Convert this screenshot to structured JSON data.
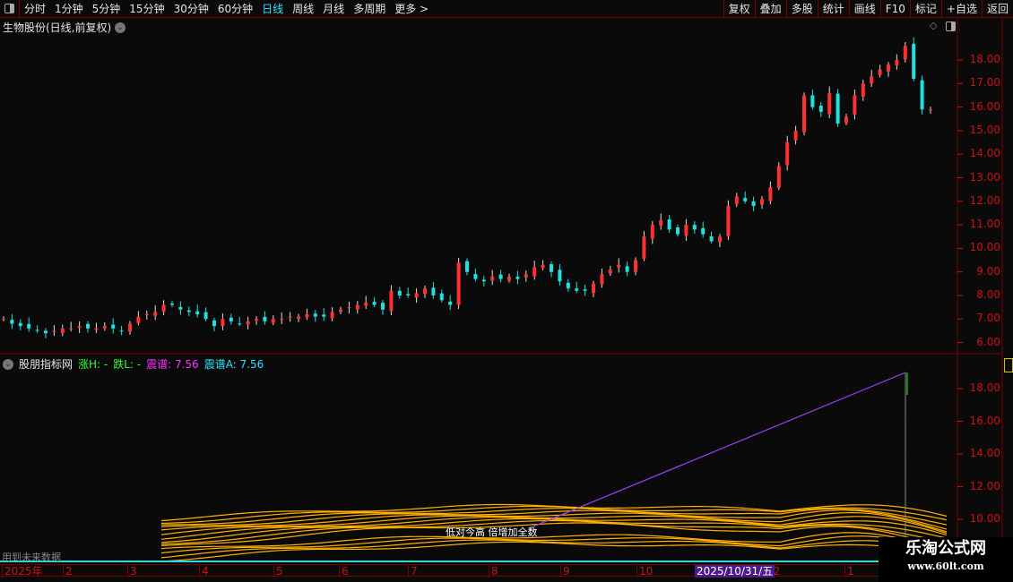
{
  "toolbar": {
    "periods": [
      "分时",
      "1分钟",
      "5分钟",
      "15分钟",
      "30分钟",
      "60分钟",
      "日线",
      "周线",
      "月线",
      "多周期",
      "更多 >"
    ],
    "active": "日线",
    "right": [
      "复权",
      "叠加",
      "多股",
      "统计",
      "画线",
      "F10",
      "标记",
      "+自选",
      "返回"
    ]
  },
  "main": {
    "title": "生物股份(日线,前复权)",
    "y_ticks": [
      "18.00",
      "17.00",
      "16.00",
      "15.00",
      "14.00",
      "13.00",
      "12.00",
      "11.00",
      "10.00",
      "9.00",
      "8.00",
      "7.00",
      "6.00"
    ]
  },
  "indicator": {
    "name": "股朋指标网",
    "zh": "涨H: -",
    "die": "跌L: -",
    "zp": "震谱: 7.56",
    "zpa": "震谱A: 7.56",
    "y_ticks": [
      "18.00",
      "16.00",
      "14.00",
      "12.00",
      "10.00"
    ],
    "future_note": "用到未来数据",
    "overlay_text": "低对今高 倍增加全数"
  },
  "x_axis": {
    "labels": [
      "2025年",
      "2",
      "3",
      "4",
      "5",
      "6",
      "7",
      "8",
      "9",
      "10",
      "12",
      "1"
    ],
    "highlight": "2025/10/31/五"
  },
  "colors": {
    "up": "#ff3030",
    "down": "#20e0e0",
    "axis": "#d01010",
    "contour": "#ffb000",
    "line": "#9a40ff"
  },
  "chart_data": {
    "type": "candlestick",
    "closes": [
      7.0,
      6.8,
      6.7,
      6.6,
      6.5,
      6.4,
      6.5,
      6.6,
      6.6,
      6.7,
      6.6,
      6.6,
      6.7,
      6.6,
      6.5,
      6.8,
      7.1,
      7.2,
      7.3,
      7.6,
      7.6,
      7.4,
      7.3,
      7.2,
      7.0,
      6.7,
      7.0,
      6.9,
      6.8,
      6.9,
      7.0,
      6.9,
      7.0,
      7.0,
      7.1,
      7.1,
      7.2,
      7.1,
      7.1,
      7.3,
      7.4,
      7.5,
      7.6,
      7.7,
      7.6,
      7.4,
      8.2,
      8.0,
      8.0,
      8.1,
      8.3,
      8.0,
      7.8,
      7.6,
      9.4,
      9.0,
      8.7,
      8.6,
      8.8,
      8.7,
      8.8,
      8.7,
      8.9,
      9.2,
      9.3,
      9.0,
      8.6,
      8.3,
      8.2,
      8.2,
      8.5,
      8.9,
      9.1,
      9.3,
      9.0,
      9.5,
      10.5,
      11.0,
      11.2,
      10.8,
      10.6,
      11.0,
      10.8,
      10.6,
      10.3,
      10.5,
      11.8,
      12.2,
      12.0,
      11.8,
      12.1,
      12.6,
      13.5,
      14.5,
      15.0,
      16.5,
      16.0,
      15.8,
      16.6,
      15.3,
      15.6,
      16.5,
      17.0,
      17.3,
      17.6,
      17.8,
      18.0,
      18.6,
      17.2,
      15.9,
      15.9
    ],
    "ylim": [
      6,
      18.5
    ]
  },
  "logo": {
    "name": "乐淘公式网",
    "url": "www.60lt.com"
  }
}
